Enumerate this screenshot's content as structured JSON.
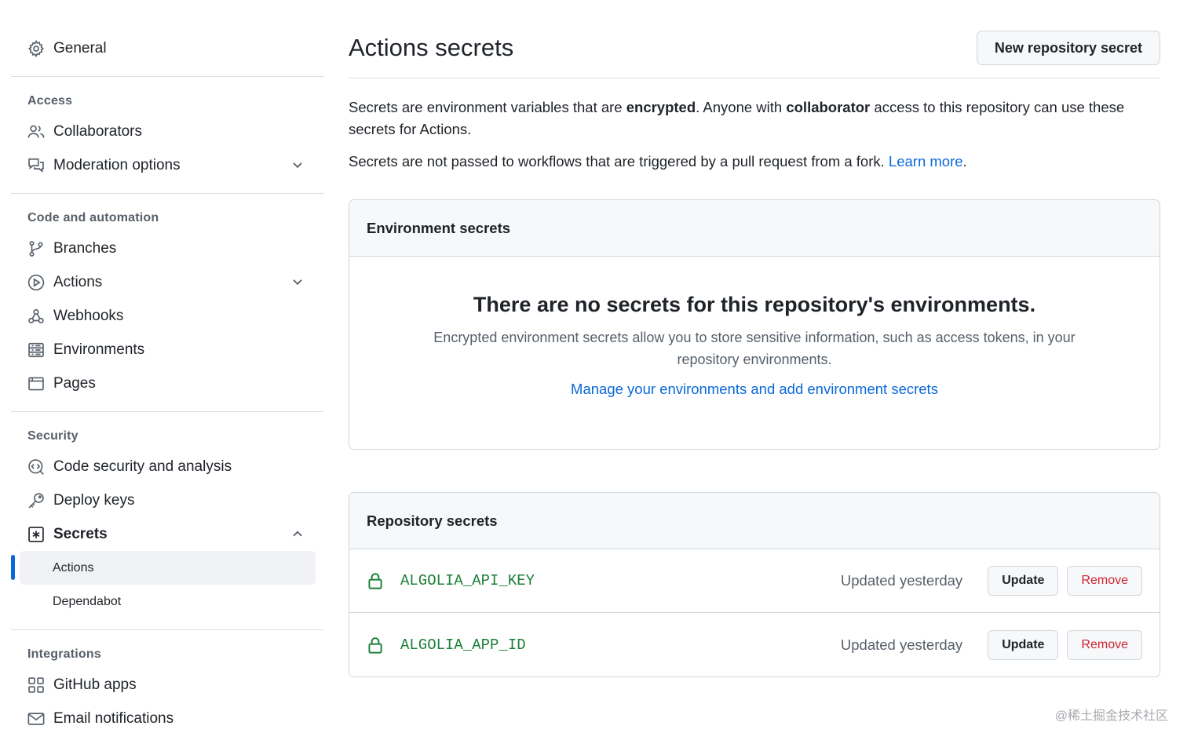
{
  "sidebar": {
    "general": "General",
    "access": {
      "label": "Access",
      "items": [
        "Collaborators",
        "Moderation options"
      ]
    },
    "code": {
      "label": "Code and automation",
      "items": [
        "Branches",
        "Actions",
        "Webhooks",
        "Environments",
        "Pages"
      ]
    },
    "security": {
      "label": "Security",
      "items": [
        "Code security and analysis",
        "Deploy keys",
        "Secrets"
      ],
      "secrets_sub": [
        "Actions",
        "Dependabot"
      ]
    },
    "integrations": {
      "label": "Integrations",
      "items": [
        "GitHub apps",
        "Email notifications"
      ]
    }
  },
  "main": {
    "title": "Actions secrets",
    "new_button": "New repository secret",
    "intro": {
      "p1_a": "Secrets are environment variables that are ",
      "p1_b": "encrypted",
      "p1_c": ". Anyone with ",
      "p1_d": "collaborator",
      "p1_e": " access to this repository can use these secrets for Actions.",
      "p2": "Secrets are not passed to workflows that are triggered by a pull request from a fork. ",
      "learn_more": "Learn more",
      "p2_end": "."
    },
    "env": {
      "header": "Environment secrets",
      "empty_title": "There are no secrets for this repository's environments.",
      "empty_desc": "Encrypted environment secrets allow you to store sensitive information, such as access tokens, in your repository environments.",
      "manage_link": "Manage your environments and add environment secrets"
    },
    "repo": {
      "header": "Repository secrets",
      "secrets": [
        {
          "name": "ALGOLIA_API_KEY",
          "updated": "Updated yesterday",
          "update": "Update",
          "remove": "Remove"
        },
        {
          "name": "ALGOLIA_APP_ID",
          "updated": "Updated yesterday",
          "update": "Update",
          "remove": "Remove"
        }
      ]
    }
  },
  "watermark": "@稀土掘金技术社区",
  "colors": {
    "link": "#0969da",
    "secret": "#1a7f37",
    "danger": "#cf222e",
    "active_bar": "#0969da"
  }
}
